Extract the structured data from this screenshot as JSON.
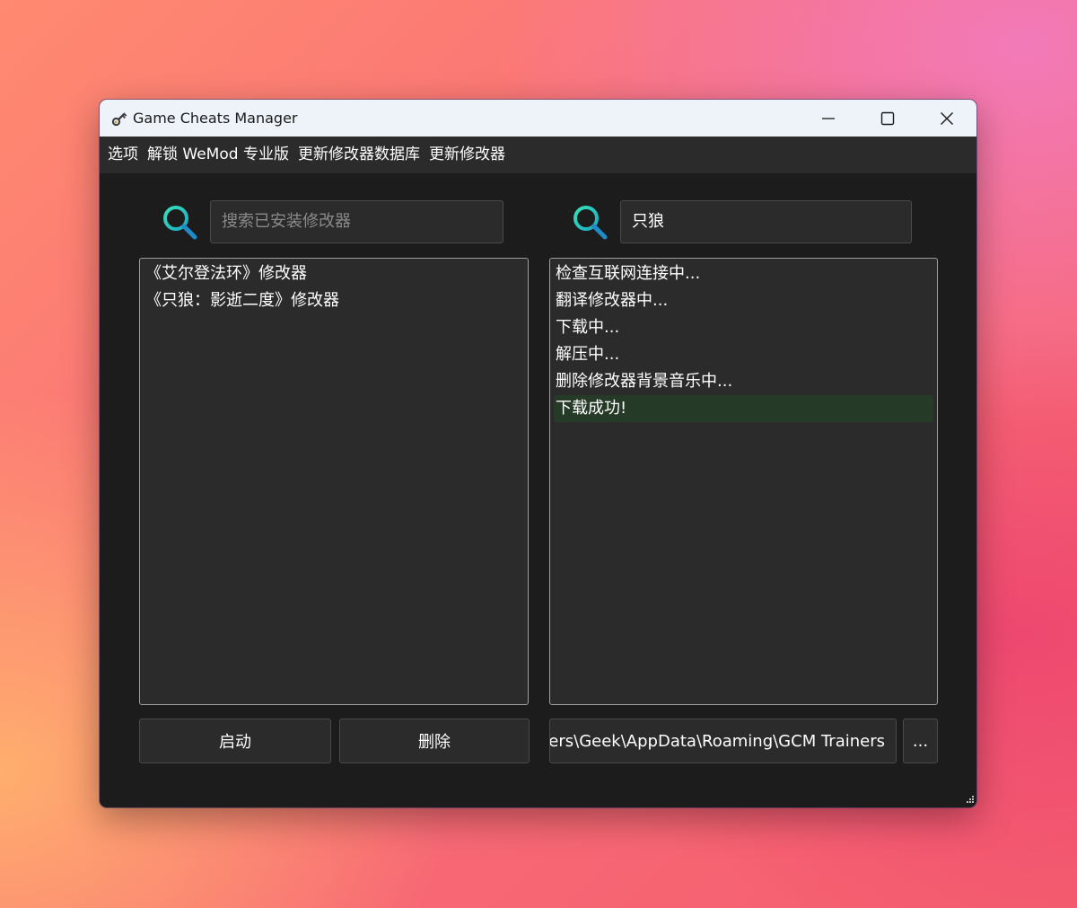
{
  "window": {
    "title": "Game Cheats Manager"
  },
  "menu": {
    "items": [
      "选项",
      "解锁 WeMod 专业版",
      "更新修改器数据库",
      "更新修改器"
    ]
  },
  "left_panel": {
    "search_placeholder": "搜索已安装修改器",
    "items": [
      "《艾尔登法环》修改器",
      "《只狼：影逝二度》修改器"
    ],
    "launch_label": "启动",
    "delete_label": "删除"
  },
  "right_panel": {
    "search_value": "只狼",
    "log": [
      "检查互联网连接中...",
      "翻译修改器中...",
      "下载中...",
      "解压中...",
      "删除修改器背景音乐中...",
      "下载成功!"
    ],
    "download_path": "C:\\Users\\Geek\\AppData\\Roaming\\GCM Trainers",
    "browse_label": "..."
  },
  "icons": {
    "app": "key-icon",
    "search": "search-icon",
    "minimize": "minimize-icon",
    "maximize": "maximize-icon",
    "close": "close-icon",
    "resize": "resize-grip-icon"
  },
  "colors": {
    "window_bg": "#1c1c1c",
    "panel_bg": "#2b2b2b",
    "titlebar_bg": "#eef3f9",
    "search_icon_ring": "#2fd4b6",
    "search_icon_handle": "#1f8cc8",
    "success_highlight": "#263a28"
  }
}
